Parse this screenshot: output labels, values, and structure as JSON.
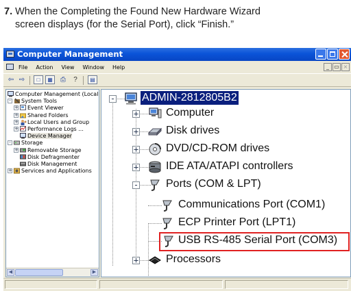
{
  "instruction": {
    "step_number": "7.",
    "line1": "When the Completing the Found New Hardware Wizard",
    "line2": "screen displays (for the Serial Port), click “Finish.”"
  },
  "window": {
    "title": "Computer Management",
    "title_color": "#0a53d8"
  },
  "menu": {
    "items": [
      "File",
      "Action",
      "View",
      "Window",
      "Help"
    ]
  },
  "left_tree": [
    {
      "label": "Computer Management (Local",
      "icon": "computer-management-icon"
    },
    {
      "label": "System Tools",
      "icon": "system-tools-icon",
      "expander": "-"
    },
    {
      "label": "Event Viewer",
      "icon": "event-viewer-icon",
      "expander": "+"
    },
    {
      "label": "Shared Folders",
      "icon": "shared-folders-icon",
      "expander": "+"
    },
    {
      "label": "Local Users and Group",
      "icon": "users-icon",
      "expander": "+"
    },
    {
      "label": "Performance Logs ...",
      "icon": "performance-icon",
      "expander": "+"
    },
    {
      "label": "Device Manager",
      "icon": "device-manager-icon"
    },
    {
      "label": "Storage",
      "icon": "storage-icon",
      "expander": "-"
    },
    {
      "label": "Removable Storage",
      "icon": "removable-storage-icon",
      "expander": "+"
    },
    {
      "label": "Disk Defragmenter",
      "icon": "defrag-icon"
    },
    {
      "label": "Disk Management",
      "icon": "disk-management-icon"
    },
    {
      "label": "Services and Applications",
      "icon": "services-icon",
      "expander": "+"
    }
  ],
  "device_tree": {
    "root": "ADMIN-2812805B2",
    "nodes": [
      {
        "label": "Computer",
        "icon": "computer-icon",
        "expander": "+"
      },
      {
        "label": "Disk drives",
        "icon": "disk-drive-icon",
        "expander": "+"
      },
      {
        "label": "DVD/CD-ROM drives",
        "icon": "cdrom-icon",
        "expander": "+"
      },
      {
        "label": "IDE ATA/ATAPI controllers",
        "icon": "ide-controller-icon",
        "expander": "+"
      },
      {
        "label": "Ports (COM & LPT)",
        "icon": "port-icon",
        "expander": "-"
      },
      {
        "label": "Communications Port (COM1)",
        "icon": "port-icon",
        "child": true
      },
      {
        "label": "ECP Printer Port (LPT1)",
        "icon": "port-icon",
        "child": true
      },
      {
        "label": "USB RS-485 Serial Port (COM3)",
        "icon": "port-icon",
        "child": true,
        "highlighted": true
      },
      {
        "label": "Processors",
        "icon": "processor-icon",
        "expander": "+"
      }
    ],
    "highlight_color": "#e02020",
    "selected_bg": "#0a1f7d"
  }
}
